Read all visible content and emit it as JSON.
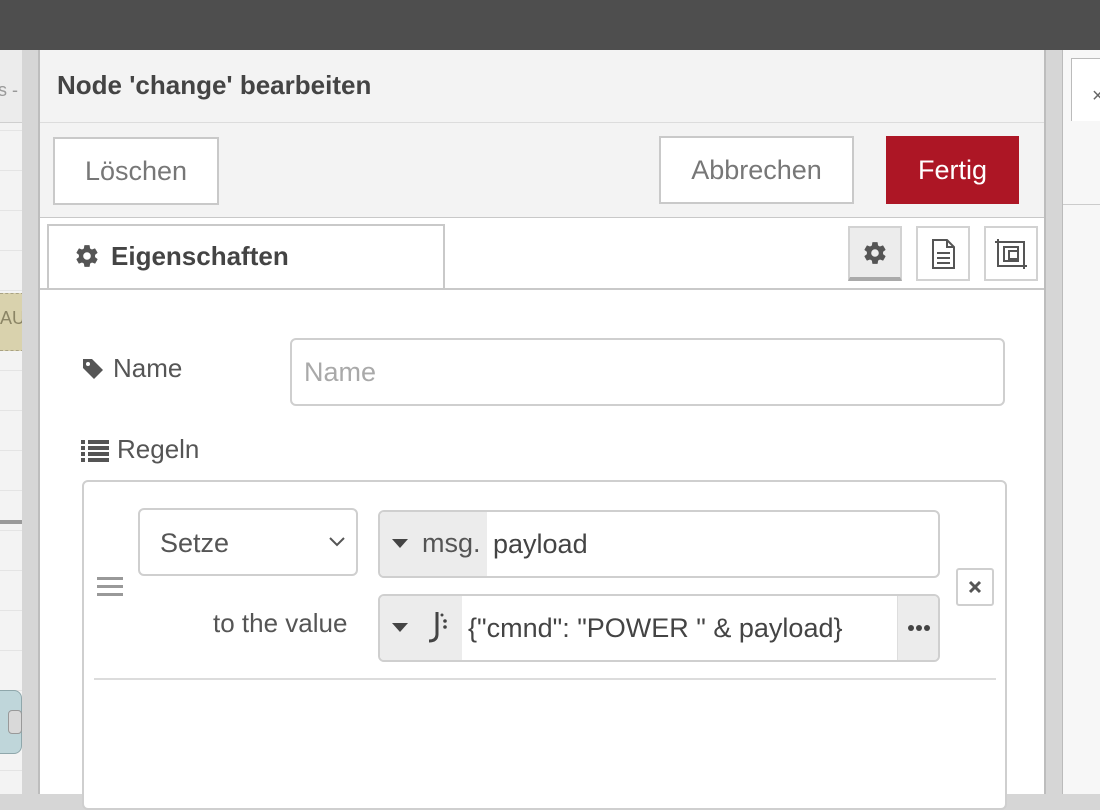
{
  "dialog": {
    "title": "Node 'change' bearbeiten",
    "buttons": {
      "delete": "Löschen",
      "cancel": "Abbrechen",
      "done": "Fertig"
    },
    "accent_color": "#ad1625"
  },
  "tabs": {
    "properties": {
      "label": "Eigenschaften",
      "icon": "gear-icon"
    },
    "toolbar_icons": [
      "gear-icon",
      "document-icon",
      "frame-icon"
    ],
    "active_icon": "gear-icon"
  },
  "form": {
    "name": {
      "label": "Name",
      "placeholder": "Name",
      "value": "",
      "icon": "tag-icon"
    },
    "rules": {
      "label": "Regeln",
      "icon": "list-icon",
      "items": [
        {
          "action": "Setze",
          "property_type": "msg.",
          "property": "payload",
          "to_value_label": "to the value",
          "value_type_icon": "jsonata-icon",
          "value": "{\"cmnd\": \"POWER \" & payload}"
        }
      ]
    }
  },
  "background": {
    "workspace_tab_text": "s -",
    "workspace_node_text": "AU",
    "sidebar_icon": "close-icon"
  }
}
